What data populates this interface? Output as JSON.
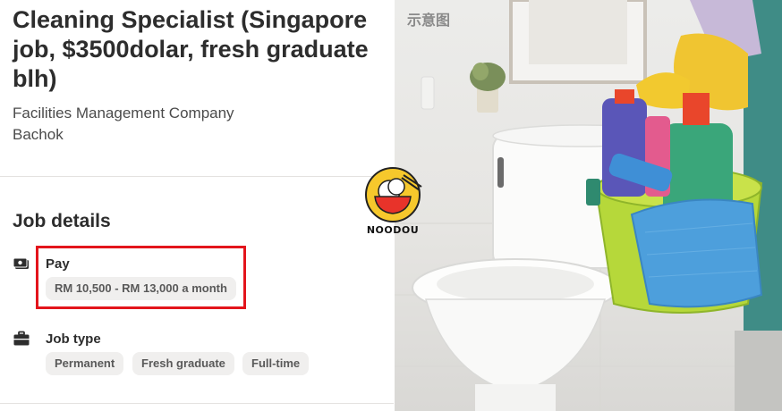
{
  "job": {
    "title": "Cleaning Specialist (Singapore job, $3500dolar, fresh graduate blh)",
    "company": "Facilities Management Company",
    "location": "Bachok"
  },
  "job_details": {
    "heading": "Job details",
    "pay": {
      "label": "Pay",
      "icon": "money-icon",
      "value": "RM 10,500 - RM 13,000 a month"
    },
    "job_type": {
      "label": "Job type",
      "icon": "briefcase-icon",
      "values": [
        "Permanent",
        "Fresh graduate",
        "Full-time"
      ]
    }
  },
  "photo": {
    "caption": "示意图",
    "subject": "toilet and cleaning supplies bucket"
  },
  "watermark": {
    "text": "NOODOU"
  },
  "colors": {
    "highlight": "#e3151c",
    "chip_bg": "#f0efee",
    "text": "#2d2d2d"
  }
}
